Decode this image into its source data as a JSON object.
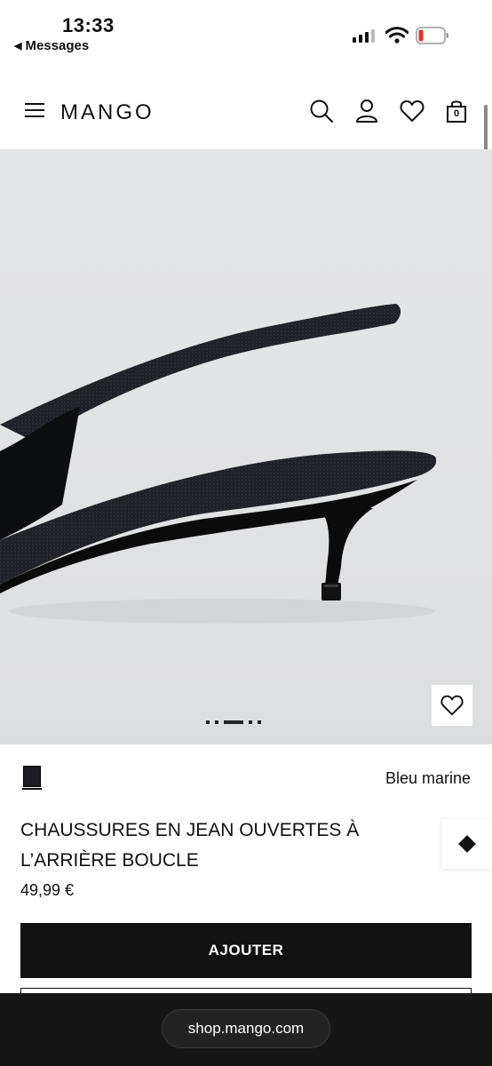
{
  "status_bar": {
    "time": "13:33",
    "back_label": "Messages"
  },
  "header": {
    "logo": "MANGO",
    "cart_count": "0"
  },
  "gallery": {
    "image_index": 3,
    "image_count": 5
  },
  "product": {
    "color_name": "Bleu marine",
    "swatch_color": "#1a1c20",
    "title": "CHAUSSURES EN JEAN OUVERTES À L’ARRIÈRE BOUCLE",
    "price": "49,99 €",
    "add_label": "AJOUTER"
  },
  "browser": {
    "url": "shop.mango.com"
  },
  "colors": {
    "accent": "#111111",
    "browser_bar": "#161616"
  }
}
